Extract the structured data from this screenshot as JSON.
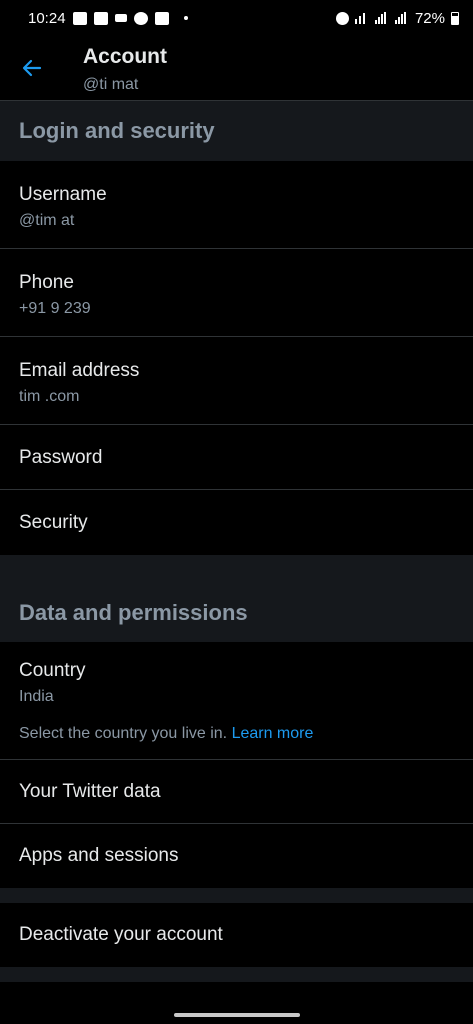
{
  "status_bar": {
    "time": "10:24",
    "battery": "72%"
  },
  "header": {
    "title": "Account",
    "handle": "@ti   mat"
  },
  "sections": {
    "login_security": "Login and security",
    "data_permissions": "Data and permissions"
  },
  "rows": {
    "username": {
      "title": "Username",
      "value": "@tim   at"
    },
    "phone": {
      "title": "Phone",
      "value": "+91 9          239"
    },
    "email": {
      "title": "Email address",
      "value": "tim              .com"
    },
    "password": {
      "title": "Password"
    },
    "security": {
      "title": "Security"
    },
    "country": {
      "title": "Country",
      "value": "India",
      "note": "Select the country you live in.",
      "link": "Learn more"
    },
    "twitter_data": {
      "title": "Your Twitter data"
    },
    "apps_sessions": {
      "title": "Apps and sessions"
    },
    "deactivate": {
      "title": "Deactivate your account"
    }
  },
  "colors": {
    "accent": "#1d9bf0",
    "background": "#000000",
    "section_bg": "#15181c",
    "secondary_text": "#8b98a5",
    "divider": "#2f3336"
  },
  "icons": {
    "back": "arrow-left-icon"
  }
}
